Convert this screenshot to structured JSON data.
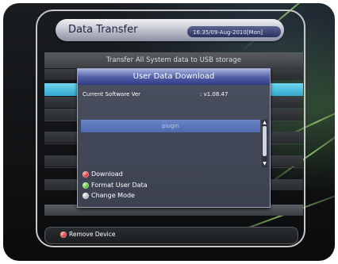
{
  "header": {
    "title": "Data Transfer",
    "datetime": "16:35/09-Aug-2010[Mon]"
  },
  "main": {
    "subtitle": "Transfer All System data to USB storage"
  },
  "dialog": {
    "title": "User Data Download",
    "software_label": "Current Software Ver",
    "software_value": ": v1.08.47",
    "list_items": [
      "plugin"
    ],
    "options": [
      {
        "label": "Download",
        "color": "red"
      },
      {
        "label": "Format User Data",
        "color": "green"
      },
      {
        "label": "Change Mode",
        "color": "white"
      }
    ]
  },
  "footer": {
    "remove_label": "Remove Device"
  },
  "colors": {
    "accent_cyan": "#34a8cf",
    "dialog_title": "#2f3b86",
    "selected_item": "#4f69ad"
  }
}
